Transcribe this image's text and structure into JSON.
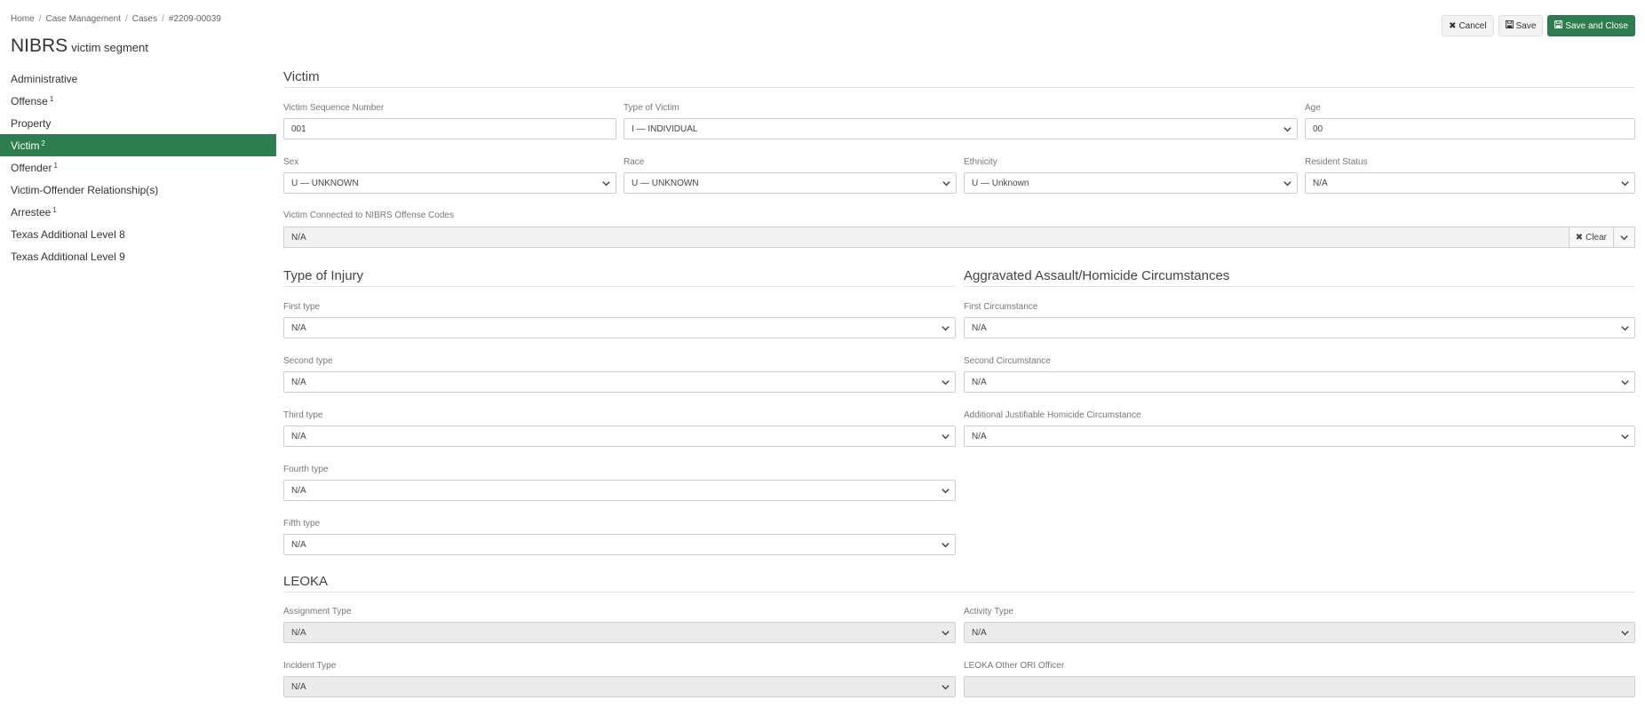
{
  "breadcrumb": [
    "Home",
    "Case Management",
    "Cases",
    "#2209-00039"
  ],
  "title": {
    "main": "NIBRS",
    "sub": "victim segment"
  },
  "actions": {
    "cancel": "Cancel",
    "save": "Save",
    "save_close": "Save and Close"
  },
  "sidebar": [
    {
      "label": "Administrative",
      "sup": ""
    },
    {
      "label": "Offense",
      "sup": "1"
    },
    {
      "label": "Property",
      "sup": ""
    },
    {
      "label": "Victim",
      "sup": "2",
      "active": true
    },
    {
      "label": "Offender",
      "sup": "1"
    },
    {
      "label": "Victim-Offender Relationship(s)",
      "sup": ""
    },
    {
      "label": "Arrestee",
      "sup": "1"
    },
    {
      "label": "Texas Additional Level 8",
      "sup": ""
    },
    {
      "label": "Texas Additional Level 9",
      "sup": ""
    }
  ],
  "victim": {
    "title": "Victim",
    "seq_label": "Victim Sequence Number",
    "seq_value": "001",
    "type_label": "Type of Victim",
    "type_value": "I — INDIVIDUAL",
    "age_label": "Age",
    "age_value": "00",
    "sex_label": "Sex",
    "sex_value": "U — UNKNOWN",
    "race_label": "Race",
    "race_value": "U — UNKNOWN",
    "ethnicity_label": "Ethnicity",
    "ethnicity_value": "U — Unknown",
    "resident_label": "Resident Status",
    "resident_value": "N/A",
    "connected_label": "Victim Connected to NIBRS Offense Codes",
    "connected_value": "N/A",
    "clear_label": "Clear"
  },
  "injury": {
    "title": "Type of Injury",
    "first_label": "First type",
    "first_value": "N/A",
    "second_label": "Second type",
    "second_value": "N/A",
    "third_label": "Third type",
    "third_value": "N/A",
    "fourth_label": "Fourth type",
    "fourth_value": "N/A",
    "fifth_label": "Fifth type",
    "fifth_value": "N/A"
  },
  "circumstances": {
    "title": "Aggravated Assault/Homicide Circumstances",
    "first_label": "First Circumstance",
    "first_value": "N/A",
    "second_label": "Second Circumstance",
    "second_value": "N/A",
    "additional_label": "Additional Justifiable Homicide Circumstance",
    "additional_value": "N/A"
  },
  "leoka": {
    "title": "LEOKA",
    "assignment_label": "Assignment Type",
    "assignment_value": "N/A",
    "activity_label": "Activity Type",
    "activity_value": "N/A",
    "incident_label": "Incident Type",
    "incident_value": "N/A",
    "other_ori_label": "LEOKA Other ORI Officer",
    "other_ori_value": ""
  },
  "colors": {
    "accent": "#2e7d4f"
  }
}
